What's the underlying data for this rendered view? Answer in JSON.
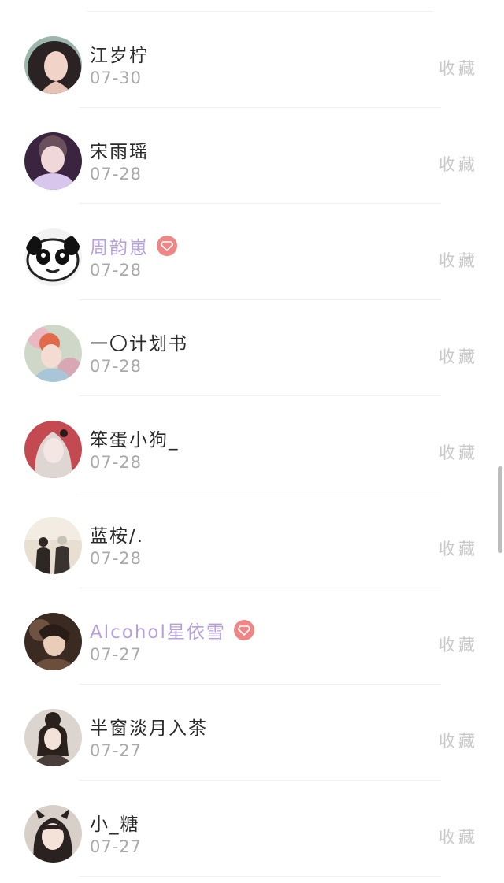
{
  "favorite_label": "收藏",
  "items": [
    {
      "name": "江岁柠",
      "date": "07-30",
      "vip": false
    },
    {
      "name": "宋雨瑶",
      "date": "07-28",
      "vip": false
    },
    {
      "name": "周韵崽",
      "date": "07-28",
      "vip": true
    },
    {
      "name": "一〇计划书",
      "date": "07-28",
      "vip": false
    },
    {
      "name": "笨蛋小狗_",
      "date": "07-28",
      "vip": false
    },
    {
      "name": "蓝桉/.",
      "date": "07-28",
      "vip": false
    },
    {
      "name": "Alcohol星依雪",
      "date": "07-27",
      "vip": true
    },
    {
      "name": "半窗淡月入茶",
      "date": "07-27",
      "vip": false
    },
    {
      "name": "小_糖",
      "date": "07-27",
      "vip": false
    }
  ],
  "colors": {
    "vip_name": "#b7a0dc",
    "vip_badge": "#f08585",
    "date": "#a9a9a9",
    "favorite": "#c9c9c9"
  }
}
